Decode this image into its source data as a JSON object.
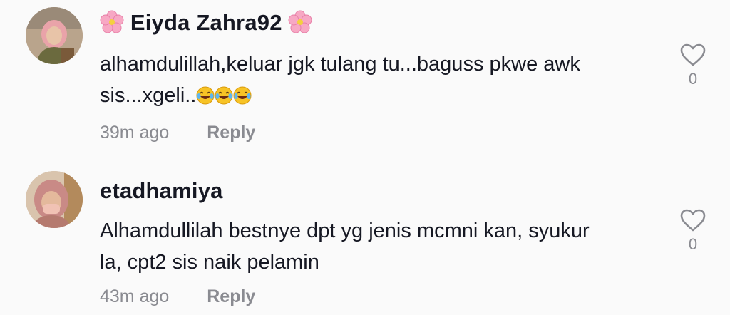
{
  "comments": [
    {
      "username": "Eiyda Zahra92",
      "username_decoration": "cherry-blossom-emoji",
      "text_line1": "alhamdulillah,keluar jgk tulang tu...baguss pkwe awk",
      "text_line2": "sis...xgeli..",
      "text_emojis": [
        "face-with-tears-of-joy",
        "face-with-tears-of-joy",
        "face-with-tears-of-joy"
      ],
      "time": "39m ago",
      "reply_label": "Reply",
      "like_icon": "heart-outline-icon",
      "like_count": "0"
    },
    {
      "username": "etadhamiya",
      "text_line1": "Alhamdullilah bestnye dpt yg jenis mcmni kan, syukur",
      "text_line2": "la, cpt2 sis naik pelamin",
      "time": "43m ago",
      "reply_label": "Reply",
      "like_icon": "heart-outline-icon",
      "like_count": "0"
    }
  ],
  "colors": {
    "background": "#fafafa",
    "text": "#161823",
    "secondary_text": "#8a8b91"
  }
}
